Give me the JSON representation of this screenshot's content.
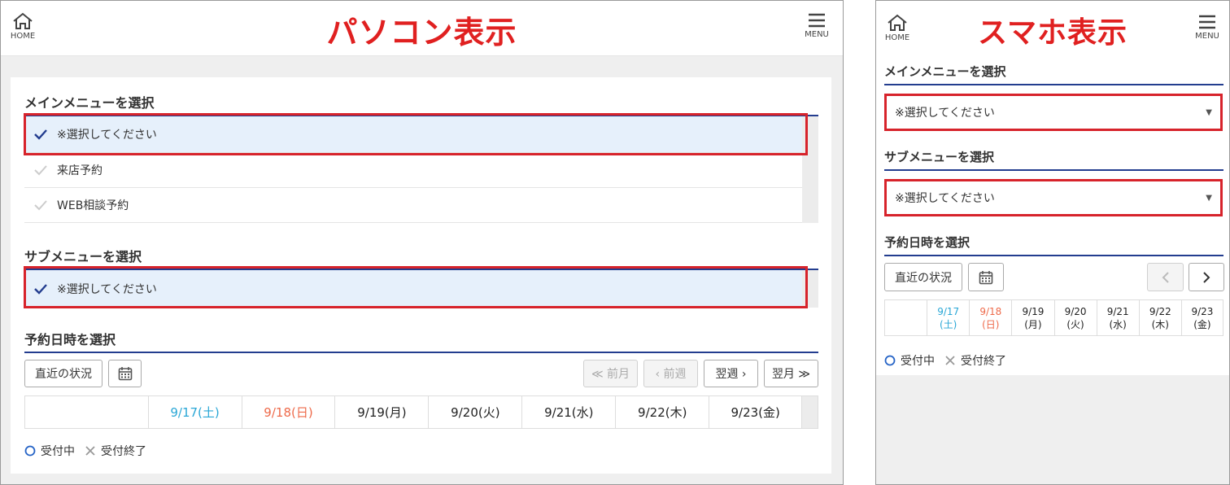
{
  "pc": {
    "home_label": "HOME",
    "menu_label": "MENU",
    "title": "パソコン表示",
    "main_heading": "メインメニューを選択",
    "main_options": [
      "※選択してください",
      "来店予約",
      "WEB相談予約"
    ],
    "sub_heading": "サブメニューを選択",
    "sub_option": "※選択してください",
    "date_heading": "予約日時を選択",
    "recent_btn": "直近の状況",
    "prev_month": "≪ 前月",
    "prev_week": "‹ 前週",
    "next_week": "翌週 ›",
    "next_month": "翌月 ≫",
    "dates": [
      "9/17(土)",
      "9/18(日)",
      "9/19(月)",
      "9/20(火)",
      "9/21(水)",
      "9/22(木)",
      "9/23(金)"
    ],
    "legend_open": "受付中",
    "legend_closed": "受付終了"
  },
  "sp": {
    "home_label": "HOME",
    "menu_label": "MENU",
    "title": "スマホ表示",
    "main_heading": "メインメニューを選択",
    "main_select": "※選択してください",
    "sub_heading": "サブメニューを選択",
    "sub_select": "※選択してください",
    "date_heading": "予約日時を選択",
    "recent_btn": "直近の状況",
    "dates": [
      {
        "d": "9/17",
        "w": "(土)"
      },
      {
        "d": "9/18",
        "w": "(日)"
      },
      {
        "d": "9/19",
        "w": "(月)"
      },
      {
        "d": "9/20",
        "w": "(火)"
      },
      {
        "d": "9/21",
        "w": "(水)"
      },
      {
        "d": "9/22",
        "w": "(木)"
      },
      {
        "d": "9/23",
        "w": "(金)"
      }
    ],
    "legend_open": "受付中",
    "legend_closed": "受付終了"
  },
  "colors": {
    "title_red": "#e02020",
    "highlight_red": "#d7232b",
    "rule_blue": "#233d8f",
    "saturday": "#2aa7d6",
    "sunday": "#ee6a4a",
    "selected_bg": "#e6f0fb"
  }
}
